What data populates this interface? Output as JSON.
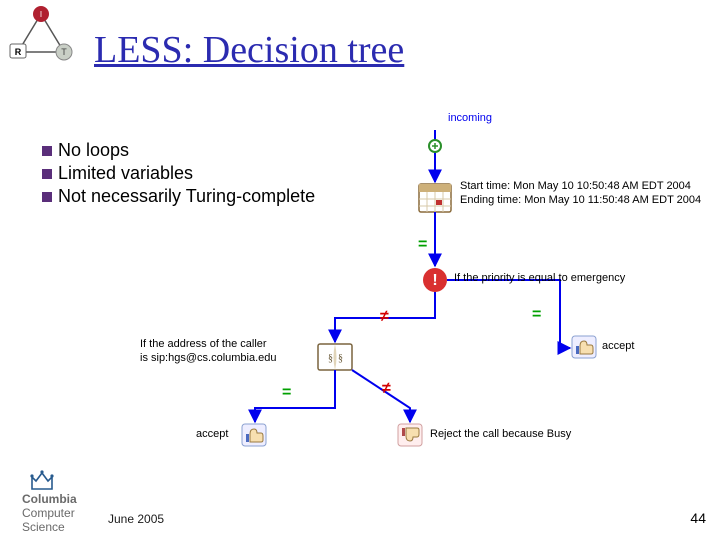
{
  "title": "LESS: Decision tree",
  "bullets": [
    "No loops",
    "Limited variables",
    "Not necessarily Turing-complete"
  ],
  "corner_nodes": {
    "top": "I",
    "left": "R",
    "right": "T"
  },
  "flow": {
    "incoming_label": "incoming",
    "time": {
      "line1": "Start time: Mon May 10 10:50:48 AM EDT 2004",
      "line2": "Ending time: Mon May 10 11:50:48 AM EDT 2004"
    },
    "priority_label": "If the priority is equal to emergency",
    "address_label_line1": "If the address of the caller",
    "address_label_line2": "is sip:hgs@cs.columbia.edu",
    "accept_right": "accept",
    "accept_bottom": "accept",
    "reject_label": "Reject the call because Busy",
    "edge_eq1": "=",
    "edge_eq2": "=",
    "edge_eq3": "=",
    "edge_ne1": "≠",
    "edge_ne2": "≠"
  },
  "colors": {
    "accent": "#2b2bb0",
    "bullet": "#5a2e7a",
    "flow_blue": "#0000ee",
    "edge_green": "#00a000",
    "edge_red": "#d40000"
  },
  "footer": {
    "inst_line1": "Columbia",
    "inst_line2": "Computer",
    "inst_line3": "Science",
    "date": "June 2005",
    "page": "44"
  }
}
